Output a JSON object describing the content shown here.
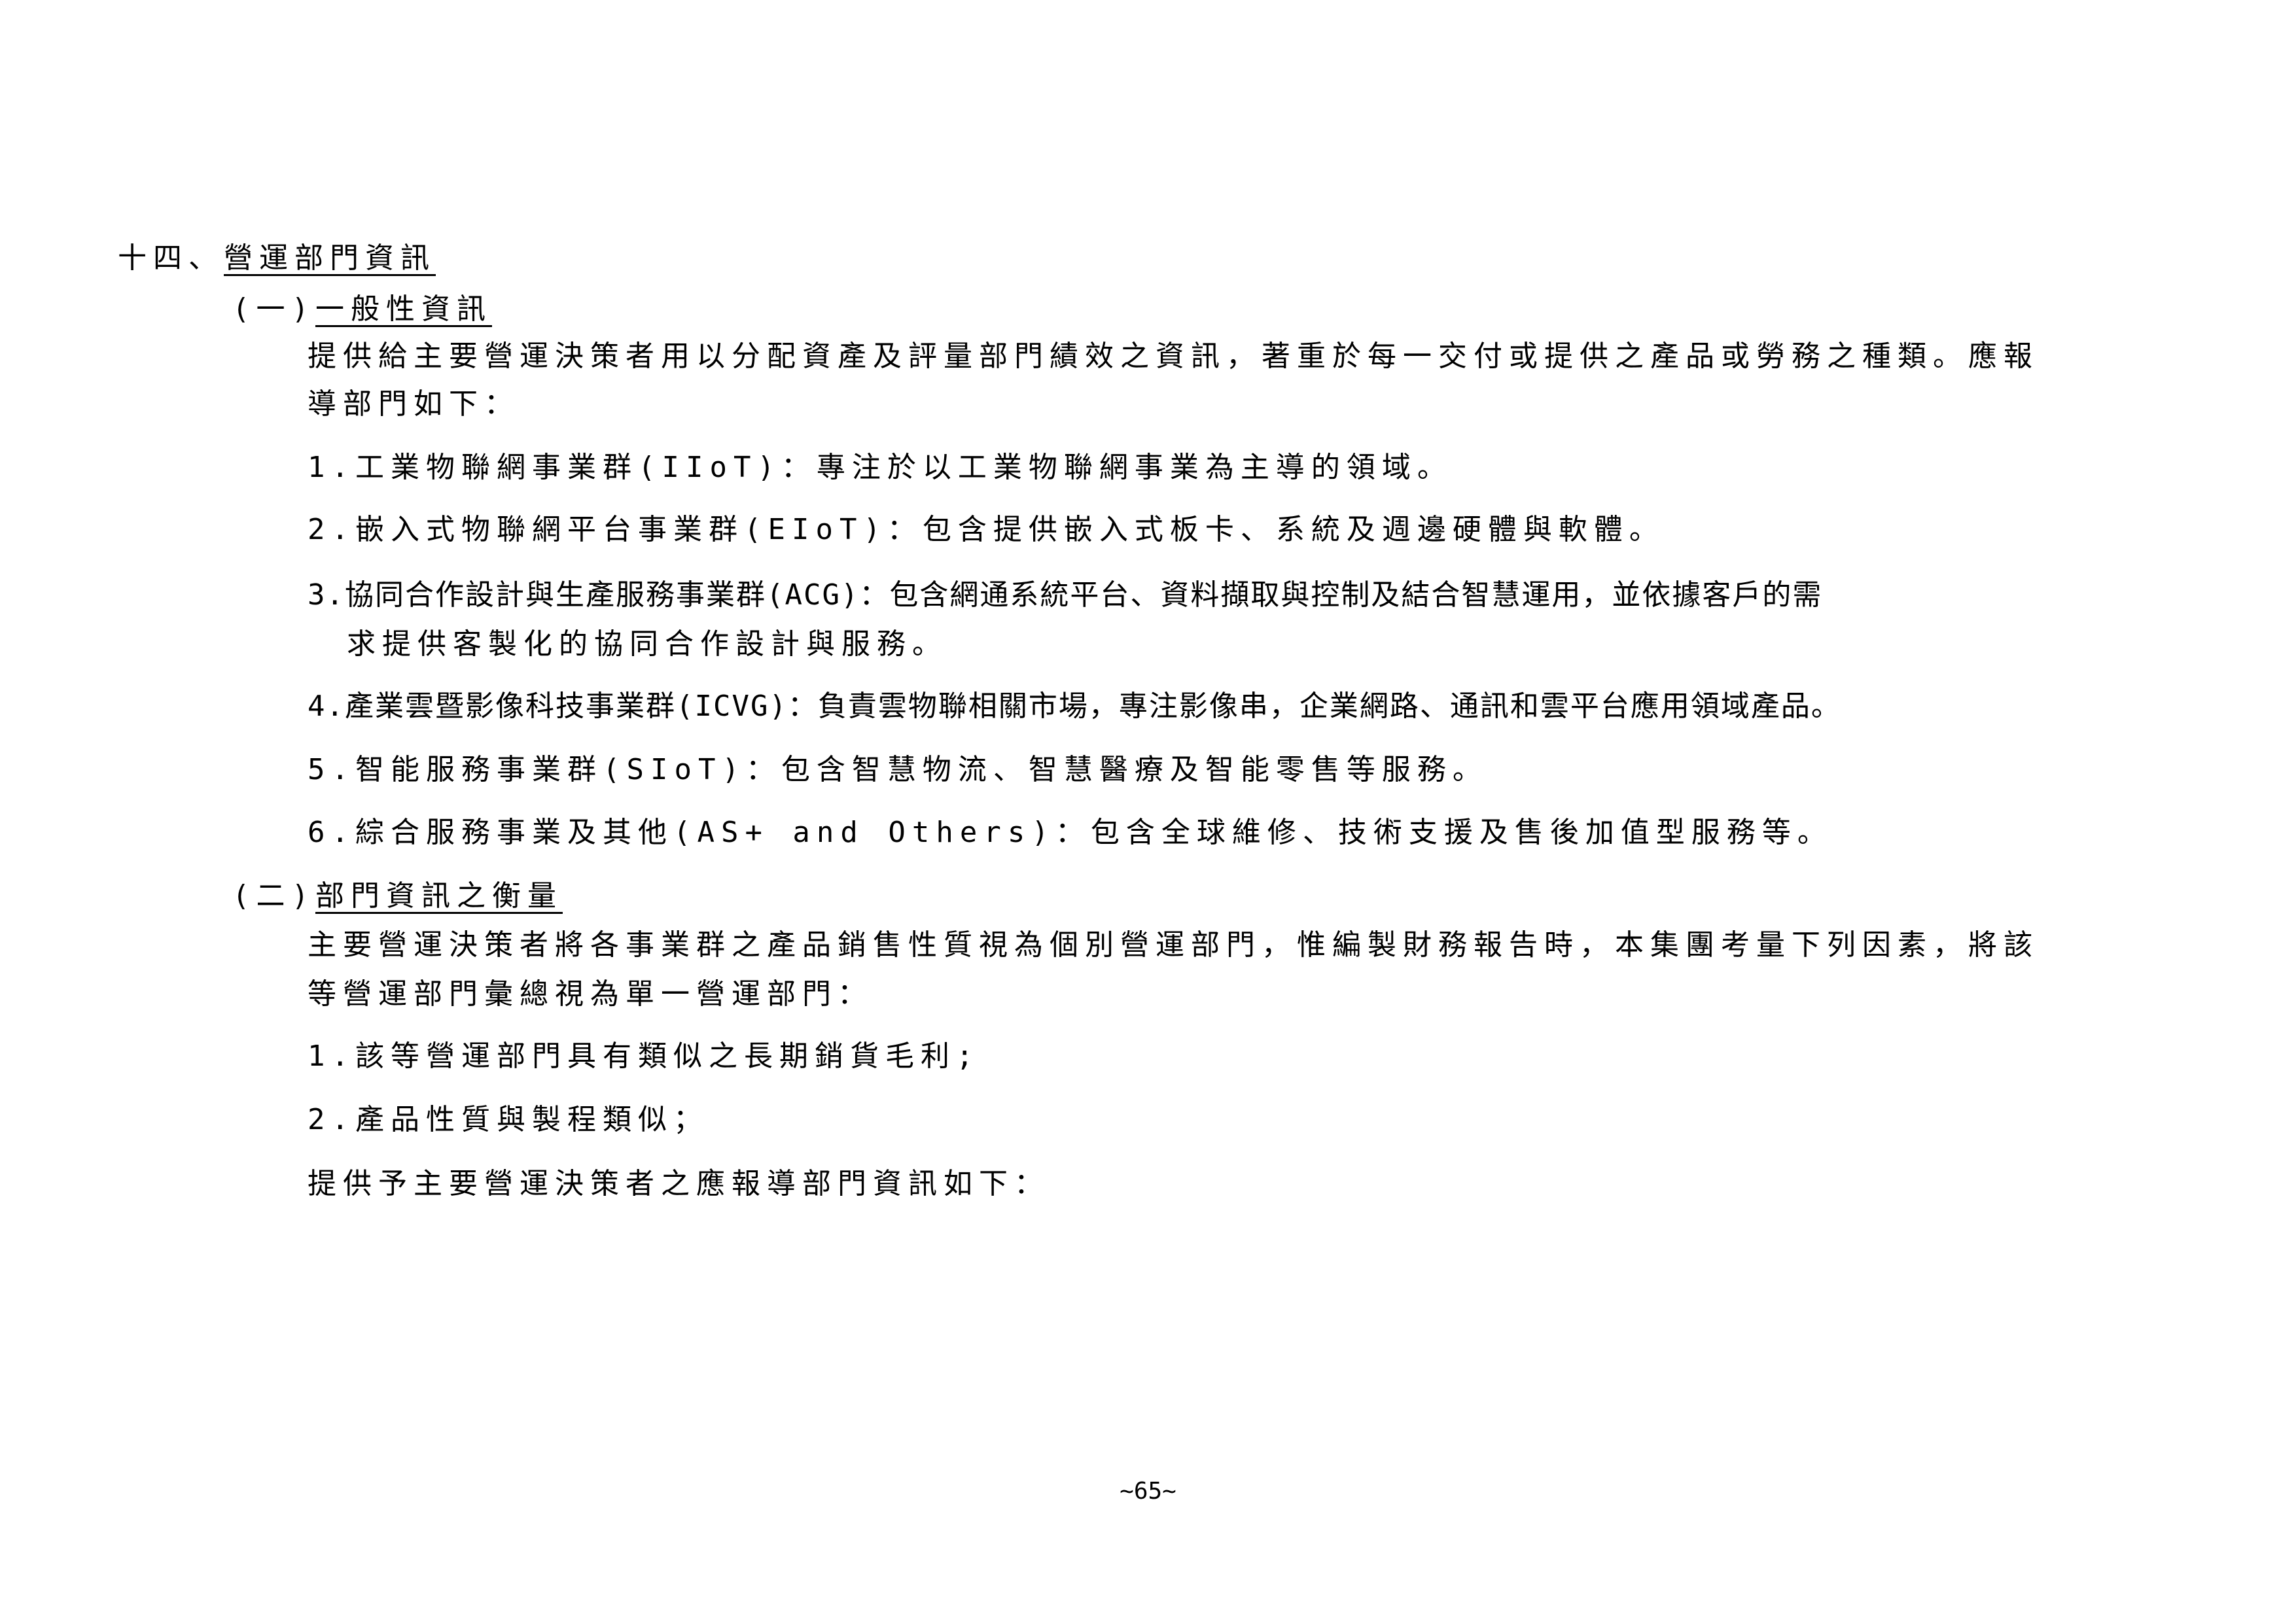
{
  "section": {
    "number": "十四、",
    "title": "營運部門資訊"
  },
  "sub1": {
    "number": "(一)",
    "title": "一般性資訊",
    "intro_line1": "提供給主要營運決策者用以分配資產及評量部門績效之資訊，著重於每一交付或提供之產品或勞務之種類。應報",
    "intro_line2": "導部門如下：",
    "items": [
      "1.工業物聯網事業群(IIoT)：專注於以工業物聯網事業為主導的領域。",
      "2.嵌入式物聯網平台事業群(EIoT)：包含提供嵌入式板卡、系統及週邊硬體與軟體。",
      "3.協同合作設計與生產服務事業群(ACG)：包含網通系統平台、資料擷取與控制及結合智慧運用，並依據客戶的需",
      "求提供客製化的協同合作設計與服務。",
      "4.產業雲暨影像科技事業群(ICVG)：負責雲物聯相關市場，專注影像串，企業網路、通訊和雲平台應用領域產品。",
      "5.智能服務事業群(SIoT)：包含智慧物流、智慧醫療及智能零售等服務。",
      "6.綜合服務事業及其他(AS+ and Others)：包含全球維修、技術支援及售後加值型服務等。"
    ]
  },
  "sub2": {
    "number": "(二)",
    "title": "部門資訊之衡量",
    "intro_line1": "主要營運決策者將各事業群之產品銷售性質視為個別營運部門，惟編製財務報告時，本集團考量下列因素，將該",
    "intro_line2": "等營運部門彙總視為單一營運部門：",
    "items": [
      "1.該等營運部門具有類似之長期銷貨毛利;",
      "2.產品性質與製程類似；"
    ],
    "closing": "提供予主要營運決策者之應報導部門資訊如下："
  },
  "footer": {
    "page_number": "~65~"
  }
}
